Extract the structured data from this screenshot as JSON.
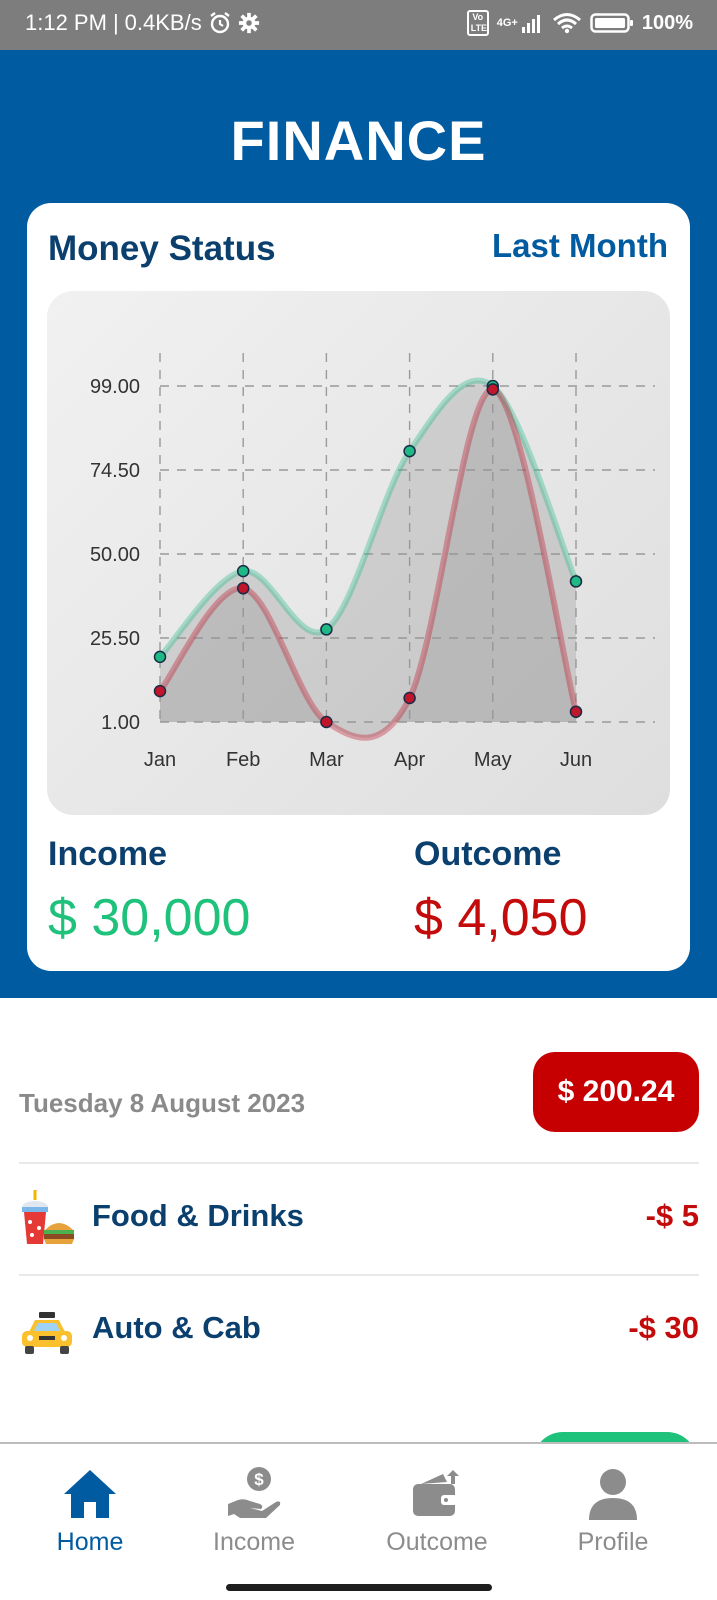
{
  "status_bar": {
    "time": "1:12 PM",
    "net_speed": "0.4KB/s",
    "network": "4G+",
    "volte": "Vo LTE",
    "battery": "100%"
  },
  "header": {
    "title": "FINANCE"
  },
  "card": {
    "title": "Money Status",
    "period": "Last Month",
    "income_label": "Income",
    "income_value": "$ 30,000",
    "outcome_label": "Outcome",
    "outcome_value": "$ 4,050"
  },
  "chart_data": {
    "type": "area",
    "categories": [
      "Jan",
      "Feb",
      "Mar",
      "Apr",
      "May",
      "Jun"
    ],
    "y_ticks": [
      "99.00",
      "74.50",
      "50.00",
      "25.50",
      "1.00"
    ],
    "ylim": [
      1,
      99
    ],
    "grid": true,
    "series": [
      {
        "values": [
          20,
          45,
          28,
          80,
          99,
          42
        ],
        "color": "#1fb985"
      },
      {
        "values": [
          10,
          40,
          1,
          8,
          98,
          4
        ],
        "color": "#c0152a"
      }
    ]
  },
  "transactions": {
    "date": "Tuesday 8 August 2023",
    "day_total": "$ 200.24",
    "items": [
      {
        "label": "Food & Drinks",
        "amount": "-$ 5",
        "icon": "food-drinks-icon"
      },
      {
        "label": "Auto & Cab",
        "amount": "-$ 30",
        "icon": "taxi-icon"
      }
    ]
  },
  "nav": {
    "items": [
      {
        "label": "Home",
        "icon": "home-icon",
        "active": true
      },
      {
        "label": "Income",
        "icon": "income-hand-dollar-icon",
        "active": false
      },
      {
        "label": "Outcome",
        "icon": "wallet-icon",
        "active": false
      },
      {
        "label": "Profile",
        "icon": "person-icon",
        "active": false
      }
    ]
  },
  "colors": {
    "primary": "#005ba1",
    "income": "#1fc27a",
    "outcome": "#c40b0b",
    "title_text": "#0b3f6e"
  }
}
